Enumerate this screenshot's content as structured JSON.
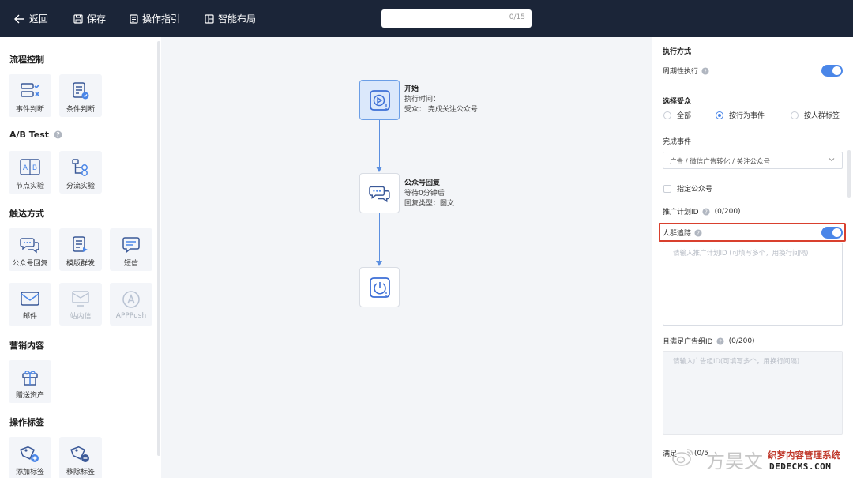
{
  "topbar": {
    "back_label": "返回",
    "save_label": "保存",
    "guide_label": "操作指引",
    "layout_label": "智能布局",
    "title_input_value": "",
    "title_counter": "0/15"
  },
  "palette": {
    "sections": [
      {
        "title": "流程控制",
        "items": [
          {
            "label": "事件判断",
            "icon": "event-judge-icon"
          },
          {
            "label": "条件判断",
            "icon": "condition-judge-icon"
          }
        ]
      },
      {
        "title": "A/B Test",
        "items": [
          {
            "label": "节点实验",
            "icon": "ab-node-icon"
          },
          {
            "label": "分流实验",
            "icon": "split-flow-icon"
          }
        ]
      },
      {
        "title": "触达方式",
        "items": [
          {
            "label": "公众号回复",
            "icon": "chat-bubbles-icon"
          },
          {
            "label": "模版群发",
            "icon": "template-broadcast-icon"
          },
          {
            "label": "短信",
            "icon": "sms-icon"
          },
          {
            "label": "邮件",
            "icon": "mail-icon"
          },
          {
            "label": "站内信",
            "icon": "inbox-icon",
            "disabled": true
          },
          {
            "label": "APPPush",
            "icon": "app-push-icon",
            "disabled": true
          }
        ]
      },
      {
        "title": "营销内容",
        "items": [
          {
            "label": "赠送资产",
            "icon": "gift-icon"
          }
        ]
      },
      {
        "title": "操作标签",
        "items": [
          {
            "label": "添加标签",
            "icon": "tag-add-icon"
          },
          {
            "label": "移除标签",
            "icon": "tag-remove-icon"
          }
        ]
      }
    ]
  },
  "canvas": {
    "nodes": [
      {
        "title": "开始",
        "lines": [
          "执行时间：",
          "受众：  完成关注公众号"
        ]
      },
      {
        "title": "公众号回复",
        "lines": [
          "等待0分钟后",
          "回复类型：图文"
        ]
      },
      {
        "title": "",
        "lines": []
      }
    ]
  },
  "panel": {
    "exec_title": "执行方式",
    "periodic_label": "周期性执行",
    "periodic_on": true,
    "audience_title": "选择受众",
    "audience_options": [
      "全部",
      "按行为事件",
      "按人群标签"
    ],
    "audience_selected": "按行为事件",
    "event_title": "完成事件",
    "event_value": "广告 / 微信广告转化 / 关注公众号",
    "account_checkbox_label": "指定公众号",
    "plan_id_label": "推广计划ID",
    "plan_id_count": "(0/200)",
    "crowd_label": "人群追踪",
    "crowd_on": true,
    "plan_placeholder": "请输入推广计划ID (可填写多个，用换行间隔)",
    "adgroup_label": "且满足广告组ID",
    "adgroup_count": "(0/200)",
    "adgroup_placeholder": "请输入广告组ID(可填写多个，用换行间隔)",
    "bottom_label_start": "满足",
    "bottom_count": "(0/5"
  },
  "watermark": {
    "faint": "方昊文",
    "cms": "织梦内容管理系统",
    "site": "DEDECMS.COM"
  },
  "colors": {
    "topbar": "#1b2538",
    "accent": "#4a86e8",
    "highlight": "#d9402e"
  }
}
